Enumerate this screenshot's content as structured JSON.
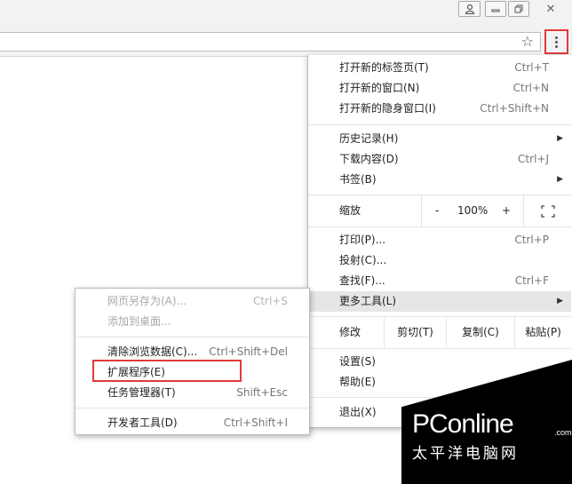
{
  "menu": {
    "items": [
      {
        "label": "打开新的标签页(T)",
        "shortcut": "Ctrl+T"
      },
      {
        "label": "打开新的窗口(N)",
        "shortcut": "Ctrl+N"
      },
      {
        "label": "打开新的隐身窗口(I)",
        "shortcut": "Ctrl+Shift+N"
      },
      {
        "label": "历史记录(H)",
        "shortcut": ""
      },
      {
        "label": "下载内容(D)",
        "shortcut": "Ctrl+J"
      },
      {
        "label": "书签(B)",
        "shortcut": ""
      },
      {
        "label": "打印(P)...",
        "shortcut": "Ctrl+P"
      },
      {
        "label": "投射(C)...",
        "shortcut": ""
      },
      {
        "label": "查找(F)...",
        "shortcut": "Ctrl+F"
      },
      {
        "label": "更多工具(L)",
        "shortcut": ""
      },
      {
        "label": "设置(S)",
        "shortcut": ""
      },
      {
        "label": "帮助(E)",
        "shortcut": ""
      },
      {
        "label": "退出(X)",
        "shortcut": ""
      }
    ],
    "zoom": {
      "label": "缩放",
      "minus": "-",
      "value": "100%",
      "plus": "+"
    },
    "edit": {
      "label": "修改",
      "cut": "剪切(T)",
      "copy": "复制(C)",
      "paste": "粘贴(P)"
    }
  },
  "submenu": {
    "items": [
      {
        "label": "网页另存为(A)...",
        "shortcut": "Ctrl+S"
      },
      {
        "label": "添加到桌面...",
        "shortcut": ""
      },
      {
        "label": "清除浏览数据(C)...",
        "shortcut": "Ctrl+Shift+Del"
      },
      {
        "label": "扩展程序(E)",
        "shortcut": ""
      },
      {
        "label": "任务管理器(T)",
        "shortcut": "Shift+Esc"
      },
      {
        "label": "开发者工具(D)",
        "shortcut": "Ctrl+Shift+I"
      }
    ]
  },
  "watermark": {
    "brand": "PConline",
    "domain": ".com.cn",
    "subtitle": "太平洋电脑网"
  },
  "icons": {
    "user": "user-icon",
    "minimize": "minimize-icon",
    "restore": "restore-icon",
    "close": "close-icon",
    "star": "bookmark-star-icon",
    "menu": "vertical-dots-menu-icon",
    "arrow": "submenu-arrow-icon",
    "fullscreen": "fullscreen-icon"
  },
  "colors": {
    "highlight_border": "#e03a3a",
    "hover_bg": "#e6e6e6",
    "chrome_bg": "#f2f2f2"
  }
}
